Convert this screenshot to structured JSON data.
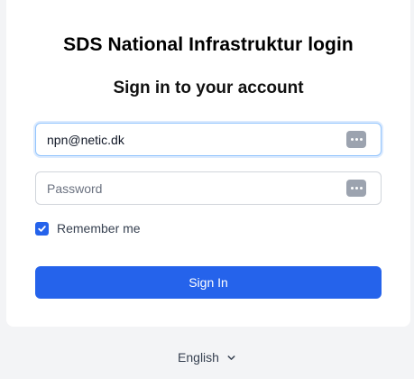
{
  "login": {
    "title": "SDS National Infrastruktur login",
    "subtitle": "Sign in to your account",
    "email_value": "npn@netic.dk",
    "password_placeholder": "Password",
    "remember_label": "Remember me",
    "remember_checked": true,
    "signin_label": "Sign In"
  },
  "footer": {
    "language": "English"
  },
  "icons": {
    "password_manager": "password-manager-key-icon",
    "checkbox": "checkmark-icon",
    "language_dropdown": "chevron-down-icon"
  },
  "colors": {
    "accent": "#2563eb",
    "background": "#f3f4f6",
    "card": "#ffffff"
  }
}
